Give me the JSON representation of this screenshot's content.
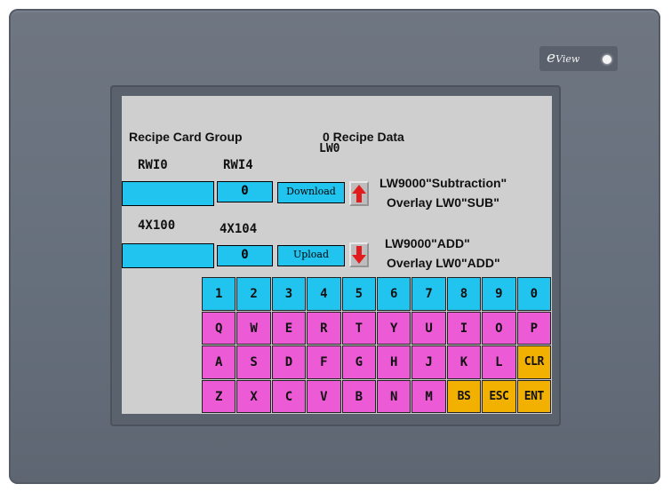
{
  "brand": {
    "logo_main": "e",
    "logo_sub": "View"
  },
  "screen": {
    "title_left": "Recipe Card Group",
    "title_right": "0 Recipe Data",
    "lw0_label": "LW0",
    "rwi0": "RWI0",
    "rwi4": "RWI4",
    "addr_100": "4X100",
    "addr_104": "4X104",
    "value_top": "0",
    "value_bottom": "0",
    "download_label": "Download",
    "upload_label": "Upload",
    "note_top_line1": "LW9000\"Subtraction\"",
    "note_top_line2": "Overlay LW0\"SUB\"",
    "note_bottom_line1": "LW9000\"ADD\"",
    "note_bottom_line2": "Overlay LW0\"ADD\""
  },
  "keyboard": {
    "rows": [
      [
        "1",
        "2",
        "3",
        "4",
        "5",
        "6",
        "7",
        "8",
        "9",
        "0"
      ],
      [
        "Q",
        "W",
        "E",
        "R",
        "T",
        "Y",
        "U",
        "I",
        "O",
        "P"
      ],
      [
        "A",
        "S",
        "D",
        "F",
        "G",
        "H",
        "J",
        "K",
        "L",
        "CLR"
      ],
      [
        "Z",
        "X",
        "C",
        "V",
        "B",
        "N",
        "M",
        "BS",
        "ESC",
        "ENT"
      ]
    ]
  },
  "colors": {
    "field": "#20c4ee",
    "key_alpha": "#ec5ad6",
    "key_func": "#f2b000",
    "screen_bg": "#cfcfcf",
    "bezel": "#6a717d"
  }
}
